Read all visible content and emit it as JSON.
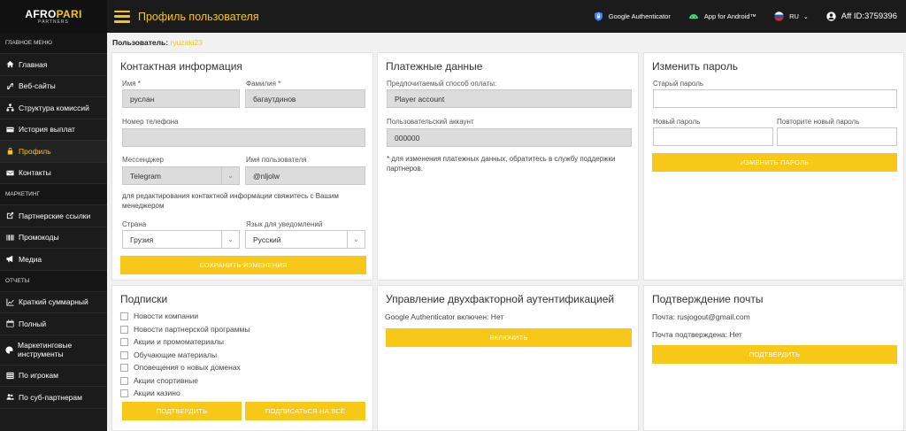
{
  "brand": {
    "name_a": "AFRO",
    "name_b": "PARI",
    "sub": "PARTNERS"
  },
  "header": {
    "title": "Профиль пользователя",
    "google_auth": "Google Authenticator",
    "android": "App for Android™",
    "lang": "RU",
    "aff": "Aff ID:3759396"
  },
  "sidebar": {
    "main_section": "ГЛАВНОЕ МЕНЮ",
    "main_items": [
      {
        "label": "Главная"
      },
      {
        "label": "Веб-сайты"
      },
      {
        "label": "Структура комиссий"
      },
      {
        "label": "История выплат"
      },
      {
        "label": "Профиль"
      },
      {
        "label": "Контакты"
      }
    ],
    "marketing_section": "МАРКЕТИНГ",
    "marketing_items": [
      {
        "label": "Партнерские ссылки"
      },
      {
        "label": "Промокоды"
      },
      {
        "label": "Медиа"
      }
    ],
    "reports_section": "ОТЧЕТЫ",
    "reports_items": [
      {
        "label": "Краткий суммарный"
      },
      {
        "label": "Полный"
      },
      {
        "label": "Маркетинговые инструменты"
      },
      {
        "label": "По игрокам"
      },
      {
        "label": "По суб-партнерам"
      }
    ]
  },
  "user": {
    "label": "Пользователь:",
    "value": "ryuzaki23"
  },
  "contact": {
    "title": "Контактная информация",
    "first_name_label": "Имя *",
    "first_name": "руслан",
    "last_name_label": "Фамилия *",
    "last_name": "багаутдинов",
    "phone_label": "Номер телефона",
    "phone": "",
    "messenger_label": "Мессенджер",
    "messenger": "Telegram",
    "username_label": "Имя пользователя",
    "username": "@nljolw",
    "note": "для редактирования контактной информации свяжитесь с Вашим менеджером",
    "country_label": "Страна",
    "country": "Грузия",
    "lang_label": "Язык для уведомлений",
    "lang": "Русский",
    "save": "СОХРАНИТЬ ИЗМЕНЕНИЯ"
  },
  "payment": {
    "title": "Платежные данные",
    "method_label": "Предпочитаемый способ оплаты:",
    "method": "Player account",
    "account_label": "Пользовательский аккаунт",
    "account": "000000",
    "note": "* для изменения платежных данных, обратитесь в службу поддержки партнеров."
  },
  "password": {
    "title": "Изменить пароль",
    "old_label": "Старый пароль",
    "new_label": "Новый пароль",
    "repeat_label": "Повторите новый пароль",
    "button": "ИЗМЕНИТЬ ПАРОЛЬ"
  },
  "subscriptions": {
    "title": "Подписки",
    "items": [
      {
        "label": "Новости компании"
      },
      {
        "label": "Новости партнерской программы"
      },
      {
        "label": "Акции и промоматериалы"
      },
      {
        "label": "Обучающие материалы"
      },
      {
        "label": "Оповещения о новых доменах"
      },
      {
        "label": "Акции спортивные"
      },
      {
        "label": "Акции казино"
      }
    ],
    "confirm": "ПОДТВЕРДИТЬ",
    "subscribe_all": "ПОДПИСАТЬСЯ НА ВСЁ"
  },
  "twofa": {
    "title": "Управление двухфакторной аутентификацией",
    "status": "Google Authenticator включен: Нет",
    "enable": "ВКЛЮЧИТЬ"
  },
  "email": {
    "title": "Подтверждение почты",
    "email_line": "Почта: rusjogout@gmail.com",
    "confirmed_line": "Почта подтверждена: Нет",
    "confirm": "ПОДТВЕРДИТЬ"
  },
  "colors": {
    "accent": "#f8c819",
    "sidebar": "#1b1b1b"
  }
}
